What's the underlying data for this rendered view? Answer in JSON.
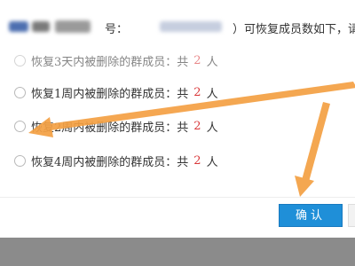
{
  "header": {
    "text_part1": "号：",
    "text_part2": "）可恢复成员数如下，请选择"
  },
  "options": [
    {
      "prefix": "恢复3天内被删除的群成员：共",
      "count": "2",
      "suffix": "人"
    },
    {
      "prefix": "恢复1周内被删除的群成员：共",
      "count": "2",
      "suffix": "人"
    },
    {
      "prefix": "恢复2周内被删除的群成员：共",
      "count": "2",
      "suffix": "人"
    },
    {
      "prefix": "恢复4周内被删除的群成员：共",
      "count": "2",
      "suffix": "人"
    }
  ],
  "footer": {
    "confirm_label": "确认"
  },
  "colors": {
    "accent": "#1f8fd8",
    "count": "#d9393b",
    "arrow": "#f4a043"
  }
}
